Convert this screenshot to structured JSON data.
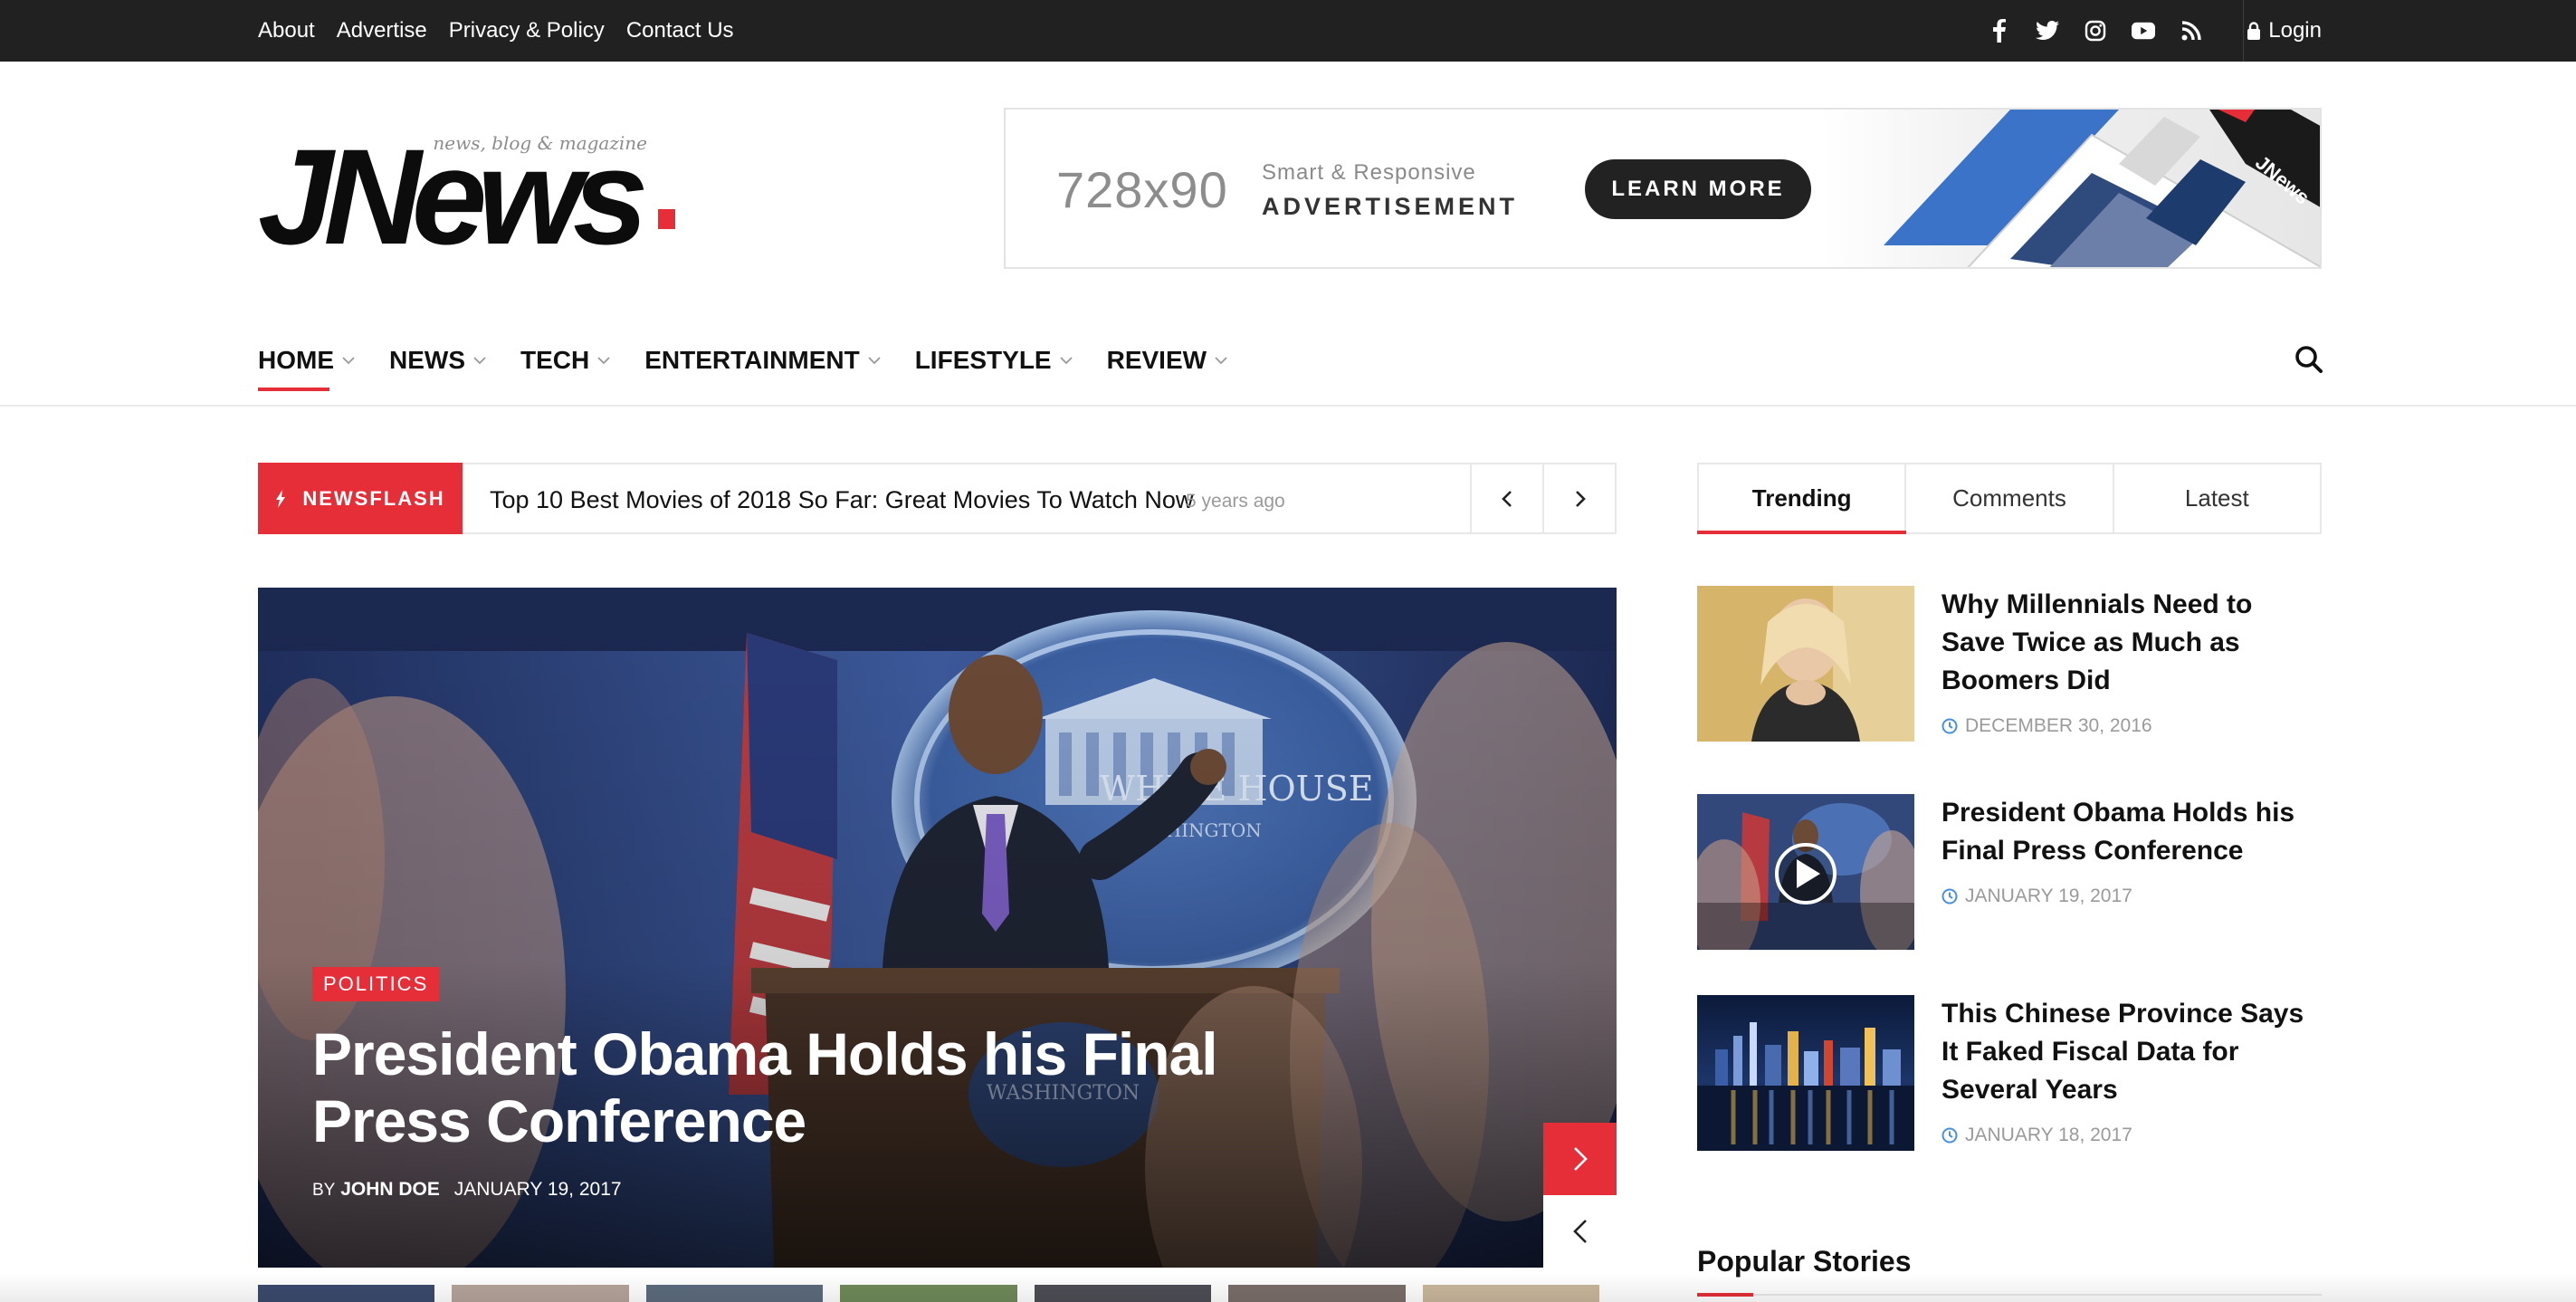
{
  "topbar": {
    "links": [
      "About",
      "Advertise",
      "Privacy & Policy",
      "Contact Us"
    ],
    "social_icons": [
      "facebook-icon",
      "twitter-icon",
      "instagram-icon",
      "youtube-icon",
      "rss-icon"
    ],
    "login_label": "Login"
  },
  "header": {
    "logo_text": "JNews",
    "tagline": "news, blog & magazine",
    "ad": {
      "size_text": "728x90",
      "line1": "Smart & Responsive",
      "line2": "ADVERTISEMENT",
      "button_label": "LEARN MORE"
    }
  },
  "nav": {
    "items": [
      "HOME",
      "NEWS",
      "TECH",
      "ENTERTAINMENT",
      "LIFESTYLE",
      "REVIEW"
    ],
    "active_index": 0
  },
  "newsflash": {
    "label": "NEWSFLASH",
    "headline": "Top 10 Best Movies of 2018 So Far: Great Movies To Watch Now",
    "time_ago": "5 years ago"
  },
  "hero": {
    "category": "POLITICS",
    "title": "President Obama Holds his Final Press Conference",
    "by": "BY",
    "author": "JOHN DOE",
    "date": "JANUARY 19, 2017"
  },
  "sidebar": {
    "tabs": [
      "Trending",
      "Comments",
      "Latest"
    ],
    "active_tab": "Trending",
    "posts": [
      {
        "title": "Why Millennials Need to Save Twice as Much as Boomers Did",
        "date": "DECEMBER 30, 2016"
      },
      {
        "title": "President Obama Holds his Final Press Conference",
        "date": "JANUARY 19, 2017"
      },
      {
        "title": "This Chinese Province Says It Faked Fiscal Data for Several Years",
        "date": "JANUARY 18, 2017"
      }
    ],
    "popular_heading": "Popular Stories"
  },
  "colors": {
    "accent": "#e52e38",
    "topbar_bg": "#212121",
    "date_icon": "#4a90e2"
  }
}
